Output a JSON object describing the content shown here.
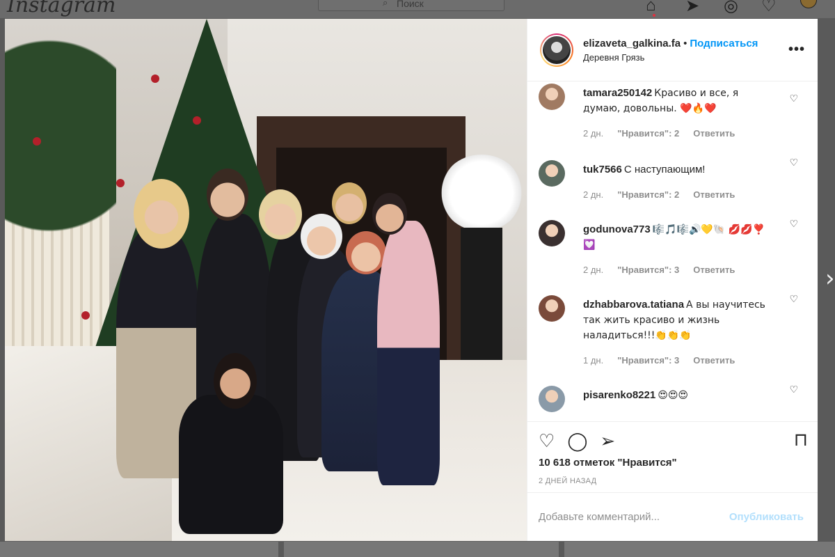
{
  "background": {
    "logo": "Instagram",
    "search_placeholder": "Поиск",
    "nav_icons": [
      "home-icon",
      "direct-icon",
      "explore-icon",
      "heart-icon"
    ]
  },
  "post": {
    "username": "elizaveta_galkina.fa",
    "separator": "•",
    "follow_label": "Подписаться",
    "location": "Деревня Грязь",
    "more_label": "•••"
  },
  "comments": [
    {
      "user": "tamara250142",
      "text": "Красиво и все, я думаю, довольны. ❤️🔥❤️",
      "age": "2 дн.",
      "likes": "\"Нравится\": 2",
      "reply": "Ответить",
      "avatar_color": "#a07a62"
    },
    {
      "user": "tuk7566",
      "text": "С наступающим!",
      "age": "2 дн.",
      "likes": "\"Нравится\": 2",
      "reply": "Ответить",
      "avatar_color": "#5a6a60"
    },
    {
      "user": "godunova773",
      "text": "🎼🎵🎼🔊💛🐚 💋💋❣️💟",
      "age": "2 дн.",
      "likes": "\"Нравится\": 3",
      "reply": "Ответить",
      "avatar_color": "#3a3030"
    },
    {
      "user": "dzhabbarova.tatiana",
      "text": "А вы научитесь так жить красиво и жизнь наладиться!!!👏👏👏",
      "age": "1 дн.",
      "likes": "\"Нравится\": 3",
      "reply": "Ответить",
      "avatar_color": "#7a4a3a"
    },
    {
      "user": "pisarenko8221",
      "text": "😍😍😍",
      "age": "",
      "likes": "",
      "reply": "",
      "avatar_color": "#8a9aa8"
    }
  ],
  "actions": {
    "likes_count": "10 618 отметок \"Нравится\"",
    "date": "2 ДНЕЙ НАЗАД",
    "comment_placeholder": "Добавьте комментарий...",
    "publish_label": "Опубликовать"
  },
  "colors": {
    "accent": "#0095f6",
    "publish_disabled": "#b2dffc",
    "muted": "#8e8e8e"
  }
}
